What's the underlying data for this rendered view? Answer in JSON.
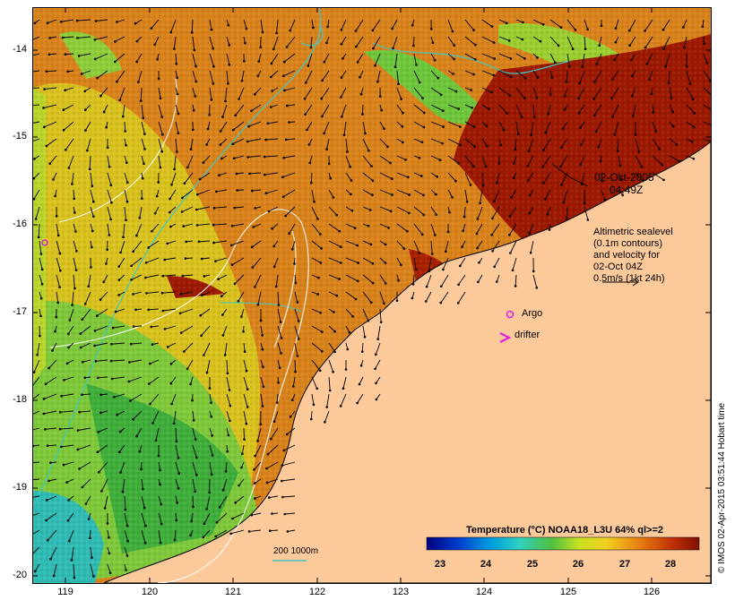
{
  "map": {
    "y_ticks": [
      "-14",
      "-15",
      "-16",
      "-17",
      "-18",
      "-19",
      "-20"
    ],
    "x_ticks": [
      "119",
      "120",
      "121",
      "122",
      "123",
      "124",
      "125",
      "126"
    ],
    "date_line1": "02-Oct-2005",
    "date_line2": "04:49Z",
    "legend_lines": [
      "Altimetric sealevel",
      "(0.1m contours)",
      "and velocity for",
      "02-Oct 04Z",
      "0.5m/s (1kt 24h)"
    ],
    "argo_label": "Argo",
    "drifter_label": "drifter",
    "isobath_label": "200  1000m",
    "colorbar_title": "Temperature (°C) NOAA18_L3U 64% ql>=2",
    "colorbar_ticks": [
      "23",
      "24",
      "25",
      "26",
      "27",
      "28"
    ],
    "credit": "© IMOS 02-Apr-2015 03:51:44 Hobart time",
    "colors": {
      "land": "#fcc99a",
      "warm": "#9c1800",
      "orange": "#d97a10",
      "yellow": "#e8d41a",
      "green": "#5cc43a",
      "cyan": "#30c8c0",
      "isobath": "#40c8c0",
      "marker": "#e020e0"
    }
  }
}
